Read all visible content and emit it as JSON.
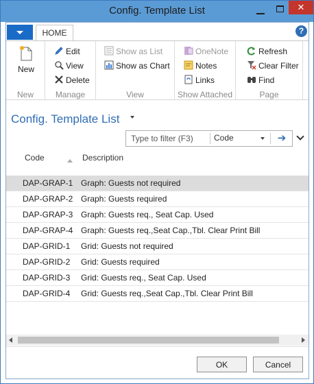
{
  "window": {
    "title": "Config. Template List"
  },
  "ribbon": {
    "tab_label": "HOME",
    "groups": {
      "new": {
        "label": "New",
        "new_label": "New"
      },
      "manage": {
        "label": "Manage",
        "edit_label": "Edit",
        "view_label": "View",
        "delete_label": "Delete"
      },
      "view": {
        "label": "View",
        "show_as_list_label": "Show as List",
        "show_as_chart_label": "Show as Chart"
      },
      "show_attached": {
        "label": "Show Attached",
        "onenote_label": "OneNote",
        "notes_label": "Notes",
        "links_label": "Links"
      },
      "page": {
        "label": "Page",
        "refresh_label": "Refresh",
        "clear_filter_label": "Clear Filter",
        "find_label": "Find"
      }
    }
  },
  "page": {
    "title": "Config. Template List"
  },
  "filter": {
    "placeholder": "Type to filter (F3)",
    "field": "Code"
  },
  "table": {
    "columns": {
      "code": "Code",
      "description": "Description"
    },
    "rows": [
      {
        "code": "DAP-GRAP-1",
        "description": "Graph: Guests not required"
      },
      {
        "code": "DAP-GRAP-2",
        "description": "Graph: Guests required"
      },
      {
        "code": "DAP-GRAP-3",
        "description": "Graph: Guests req., Seat Cap. Used"
      },
      {
        "code": "DAP-GRAP-4",
        "description": "Graph: Guests req.,Seat Cap.,Tbl. Clear Print Bill"
      },
      {
        "code": "DAP-GRID-1",
        "description": "Grid: Guests not required"
      },
      {
        "code": "DAP-GRID-2",
        "description": "Grid: Guests required"
      },
      {
        "code": "DAP-GRID-3",
        "description": "Grid: Guests req., Seat Cap. Used"
      },
      {
        "code": "DAP-GRID-4",
        "description": "Grid: Guests req.,Seat Cap.,Tbl. Clear Print Bill"
      }
    ],
    "selected_row": 0
  },
  "footer": {
    "ok_label": "OK",
    "cancel_label": "Cancel"
  },
  "icons": {
    "new": "new-document-icon",
    "edit": "pencil-icon",
    "view": "magnifier-icon",
    "delete": "delete-x-icon",
    "show_as_list": "list-icon",
    "show_as_chart": "chart-icon",
    "onenote": "onenote-icon",
    "notes": "notes-icon",
    "links": "links-icon",
    "refresh": "refresh-icon",
    "clear_filter": "clear-filter-icon",
    "find": "binoculars-icon"
  },
  "colors": {
    "title_bar": "#5b9bd5",
    "accent": "#2f6db5",
    "close": "#c4352c",
    "selected_row": "#dcdcdc"
  }
}
